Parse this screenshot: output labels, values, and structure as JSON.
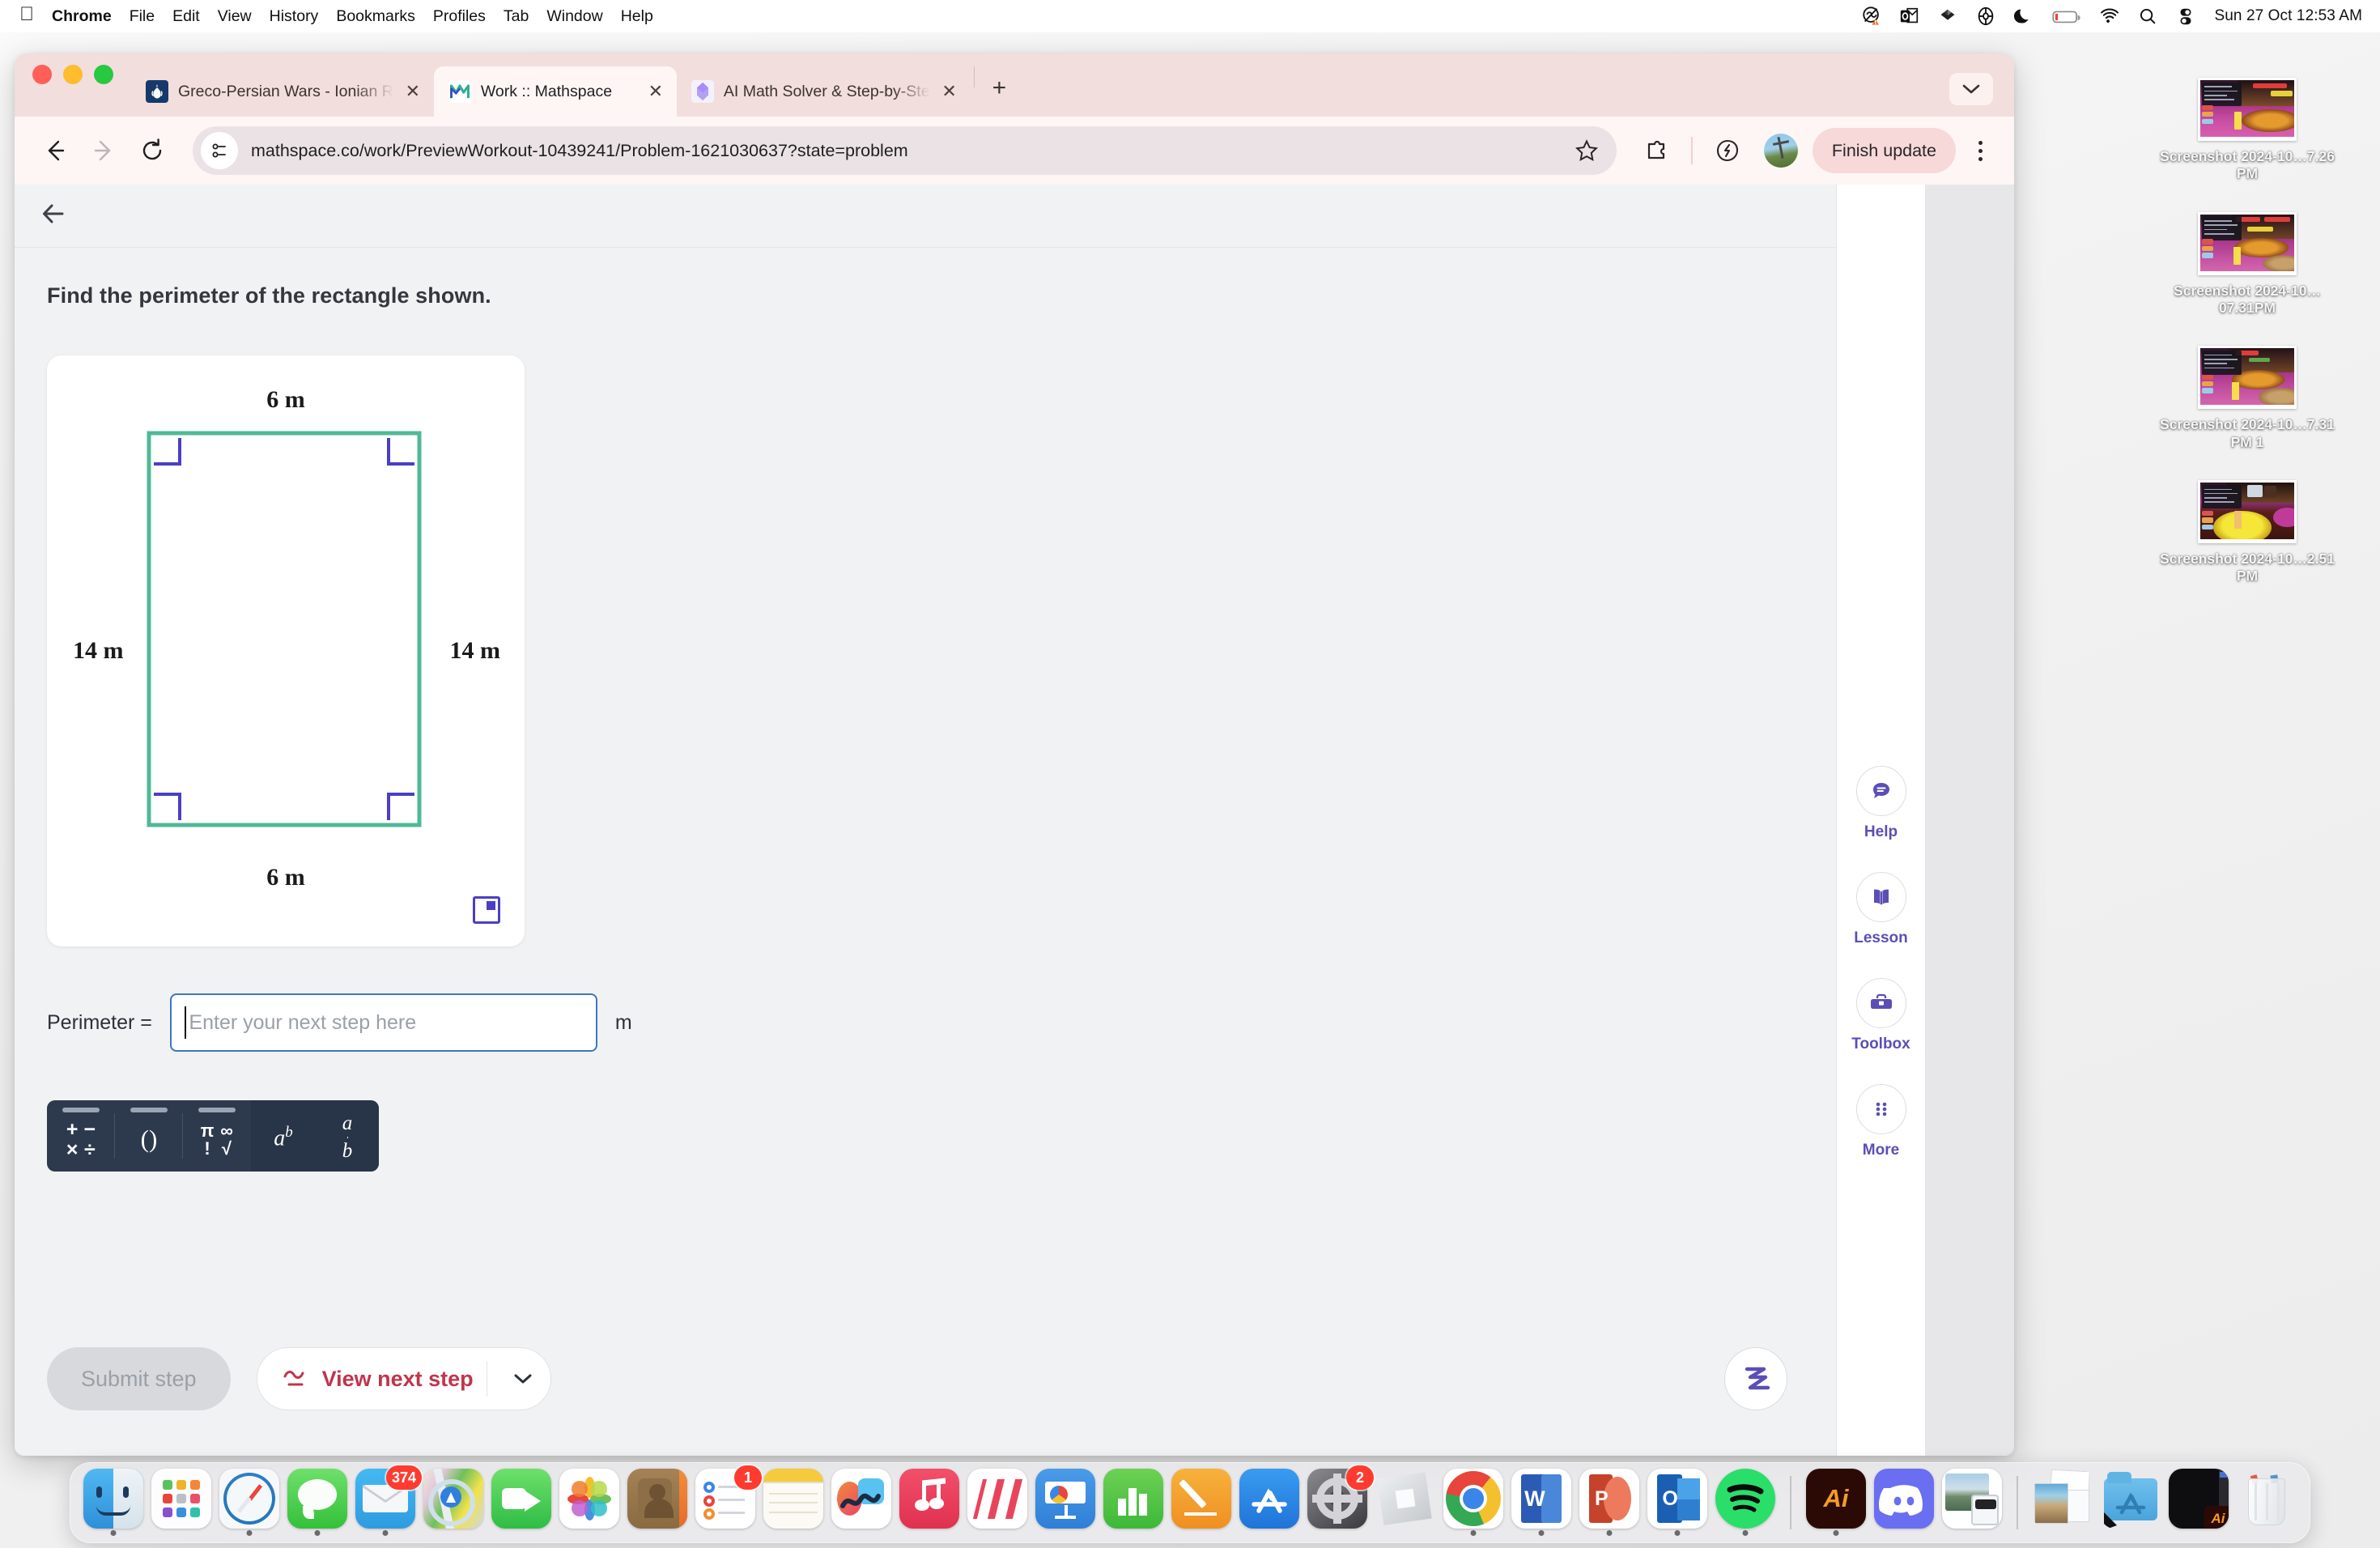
{
  "menubar": {
    "apple": "",
    "items": [
      {
        "label": "Chrome",
        "bold": true
      },
      {
        "label": "File",
        "bold": false
      },
      {
        "label": "Edit",
        "bold": false
      },
      {
        "label": "View",
        "bold": false
      },
      {
        "label": "History",
        "bold": false
      },
      {
        "label": "Bookmarks",
        "bold": false
      },
      {
        "label": "Profiles",
        "bold": false
      },
      {
        "label": "Tab",
        "bold": false
      },
      {
        "label": "Window",
        "bold": false
      },
      {
        "label": "Help",
        "bold": false
      }
    ],
    "tray_icons": [
      "nextcloud-warning-icon",
      "outlook-icon",
      "dropbox-icon",
      "lifebuoy-icon",
      "moon-dnd-icon",
      "battery-low-icon",
      "wifi-icon",
      "spotlight-search-icon",
      "control-center-icon"
    ],
    "clock": "Sun 27 Oct  12:53 AM"
  },
  "desktop_icons": [
    {
      "label": "Screenshot\n2024-10…7.26 PM",
      "icon": "screenshot-thumbnail"
    },
    {
      "label": "Screenshot\n2024-10…07.31PM",
      "icon": "screenshot-thumbnail"
    },
    {
      "label": "Screenshot\n2024-10…7.31 PM 1",
      "icon": "screenshot-thumbnail"
    },
    {
      "label": "Screenshot\n2024-10…2.51 PM",
      "icon": "screenshot-thumbnail"
    }
  ],
  "browser": {
    "tabs": [
      {
        "title": "Greco-Persian Wars - Ionian R",
        "favicon": "wikipedia-icon",
        "active": false,
        "close": "✕"
      },
      {
        "title": "Work :: Mathspace",
        "favicon": "mathspace-icon",
        "active": true,
        "close": "✕"
      },
      {
        "title": "AI Math Solver & Step-by-Ste",
        "favicon": "ai-solver-icon",
        "active": false,
        "close": "✕"
      }
    ],
    "new_tab_label": "+",
    "tab_list_chevron": "⌄",
    "toolbar": {
      "back": "←",
      "forward": "→",
      "reload": "⟳",
      "site_info_icon": "page-settings-icon",
      "url": "mathspace.co/work/PreviewWorkout-10439241/Problem-1621030637?state=problem",
      "url_highlight": "mathspace.co",
      "bookmark_icon": "star-icon",
      "extensions_icon": "puzzle-icon",
      "energy_saver_icon": "leaf-icon",
      "profile_icon": "profile-avatar",
      "update_label": "Finish update",
      "menu_icon": "kebab-menu-icon"
    }
  },
  "mathspace": {
    "back_icon": "back-arrow-icon",
    "question": "Find the perimeter of the rectangle shown.",
    "diagram": {
      "shape": "rectangle",
      "top_label": "6 m",
      "bottom_label": "6 m",
      "left_label": "14 m",
      "right_label": "14 m",
      "stroke_color": "#4fb997",
      "angle_marker_color": "#4a3fc4",
      "expand_icon": "expand-diagram-icon"
    },
    "answer": {
      "label": "Perimeter  =",
      "placeholder": "Enter your next step here",
      "value": "",
      "unit": "m"
    },
    "math_keyboard": [
      {
        "name": "operators-key",
        "glyphs": [
          "+",
          "−",
          "×",
          "÷"
        ]
      },
      {
        "name": "parentheses-key",
        "glyphs": [
          "(",
          ")"
        ]
      },
      {
        "name": "symbols-key",
        "glyphs": [
          "π",
          "∞",
          "!",
          "√"
        ]
      },
      {
        "name": "exponent-key",
        "glyphs": [
          "a",
          "b"
        ]
      },
      {
        "name": "fraction-key",
        "glyphs": [
          "a",
          "b"
        ]
      }
    ],
    "buttons": {
      "submit": "Submit step",
      "next_step": "View next step",
      "next_step_icon": "squiggle-hint-icon",
      "next_step_chevron": "⌄",
      "logo": "mathspace-logo-icon"
    },
    "rail": [
      {
        "label": "Help",
        "icon": "chat-bubble-icon"
      },
      {
        "label": "Lesson",
        "icon": "open-book-icon"
      },
      {
        "label": "Toolbox",
        "icon": "toolbox-icon"
      },
      {
        "label": "More",
        "icon": "six-dot-grid-icon"
      }
    ],
    "accent_color": "#5b4fb5"
  },
  "dock": {
    "apps": [
      {
        "name": "finder-icon",
        "running": true,
        "badge": null
      },
      {
        "name": "launchpad-icon",
        "running": false,
        "badge": null
      },
      {
        "name": "safari-icon",
        "running": true,
        "badge": null
      },
      {
        "name": "messages-icon",
        "running": true,
        "badge": null
      },
      {
        "name": "mail-icon",
        "running": true,
        "badge": "374"
      },
      {
        "name": "maps-icon",
        "running": false,
        "badge": null
      },
      {
        "name": "facetime-icon",
        "running": false,
        "badge": null
      },
      {
        "name": "photos-icon",
        "running": false,
        "badge": null
      },
      {
        "name": "contacts-icon",
        "running": false,
        "badge": null
      },
      {
        "name": "reminders-icon",
        "running": false,
        "badge": "1"
      },
      {
        "name": "notes-icon",
        "running": false,
        "badge": null
      },
      {
        "name": "freeform-icon",
        "running": false,
        "badge": null
      },
      {
        "name": "music-icon",
        "running": false,
        "badge": null
      },
      {
        "name": "news-icon",
        "running": false,
        "badge": null
      },
      {
        "name": "keynote-icon",
        "running": false,
        "badge": null
      },
      {
        "name": "numbers-icon",
        "running": false,
        "badge": null
      },
      {
        "name": "pages-icon",
        "running": false,
        "badge": null
      },
      {
        "name": "appstore-icon",
        "running": false,
        "badge": null
      },
      {
        "name": "system-settings-icon",
        "running": false,
        "badge": "2"
      },
      {
        "name": "roblox-icon",
        "running": false,
        "badge": null
      },
      {
        "name": "chrome-icon",
        "running": true,
        "badge": null
      },
      {
        "name": "word-icon",
        "running": true,
        "badge": null
      },
      {
        "name": "powerpoint-icon",
        "running": true,
        "badge": null
      },
      {
        "name": "outlook-icon",
        "running": true,
        "badge": null
      },
      {
        "name": "spotify-icon",
        "running": true,
        "badge": null
      },
      {
        "name": "divider",
        "running": false,
        "badge": null
      },
      {
        "name": "illustrator-icon",
        "running": true,
        "badge": null
      },
      {
        "name": "discord-icon",
        "running": false,
        "badge": null
      },
      {
        "name": "preview-icon",
        "running": false,
        "badge": null
      },
      {
        "name": "divider",
        "running": false,
        "badge": null
      },
      {
        "name": "image-stack-icon",
        "running": false,
        "badge": null
      },
      {
        "name": "applications-folder-icon",
        "running": false,
        "badge": null
      },
      {
        "name": "illustrator-document-icon",
        "running": false,
        "badge": null
      },
      {
        "name": "trash-full-icon",
        "running": false,
        "badge": null
      }
    ]
  }
}
